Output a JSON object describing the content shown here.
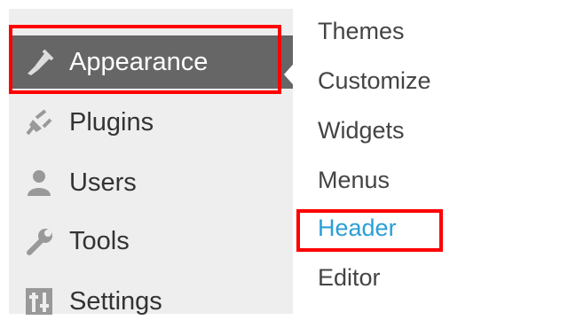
{
  "sidebar": {
    "items": [
      {
        "label": "Appearance",
        "icon": "paintbrush-icon",
        "active": true
      },
      {
        "label": "Plugins",
        "icon": "plug-icon",
        "active": false
      },
      {
        "label": "Users",
        "icon": "user-icon",
        "active": false
      },
      {
        "label": "Tools",
        "icon": "wrench-icon",
        "active": false
      },
      {
        "label": "Settings",
        "icon": "settings-sliders-icon",
        "active": false
      }
    ]
  },
  "submenu": {
    "items": [
      {
        "label": "Themes"
      },
      {
        "label": "Customize"
      },
      {
        "label": "Widgets"
      },
      {
        "label": "Menus"
      },
      {
        "label": "Header",
        "current": true
      },
      {
        "label": "Editor"
      }
    ]
  },
  "colors": {
    "active_bg": "#666666",
    "menu_bg": "#eeeeee",
    "highlight": "#ff0000",
    "current_link": "#2a9fd6"
  }
}
